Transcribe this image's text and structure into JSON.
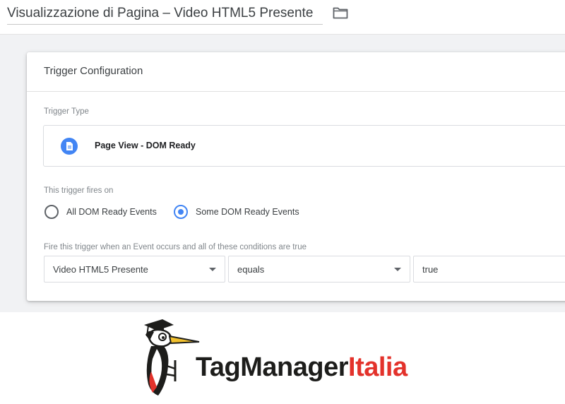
{
  "header": {
    "title": "Visualizzazione di Pagina – Video HTML5 Presente",
    "folder_icon": "folder-icon"
  },
  "card": {
    "title": "Trigger Configuration",
    "trigger_type_label": "Trigger Type",
    "trigger_type": {
      "icon": "document-icon",
      "label": "Page View - DOM Ready"
    },
    "fires_on_label": "This trigger fires on",
    "fires_on_options": [
      {
        "label": "All DOM Ready Events",
        "selected": false
      },
      {
        "label": "Some DOM Ready Events",
        "selected": true
      }
    ],
    "condition_label": "Fire this trigger when an Event occurs and all of these conditions are true",
    "condition": {
      "variable": "Video HTML5 Presente",
      "operator": "equals",
      "value": "true"
    }
  },
  "logo": {
    "text_dark": "TagManager",
    "text_red": "Italia"
  },
  "colors": {
    "accent": "#4285f4",
    "canvas_bg": "#f1f2f4",
    "logo_red": "#e3322b"
  }
}
